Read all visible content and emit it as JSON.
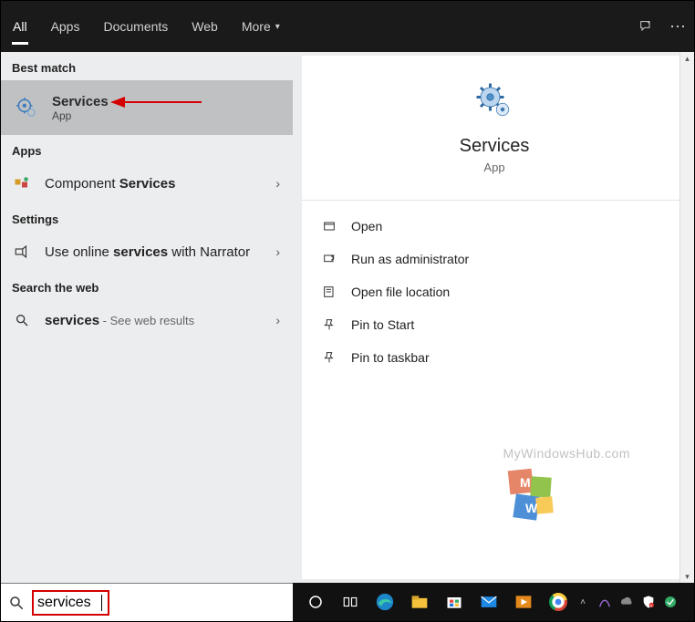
{
  "tabs": {
    "all": "All",
    "apps": "Apps",
    "documents": "Documents",
    "web": "Web",
    "more": "More"
  },
  "sections": {
    "best_match": "Best match",
    "apps": "Apps",
    "settings": "Settings",
    "search_web": "Search the web"
  },
  "best_match": {
    "title": "Services",
    "subtitle": "App"
  },
  "apps_list": {
    "component_pre": "Component ",
    "component_bold": "Services"
  },
  "settings_list": {
    "narrator_pre": "Use online ",
    "narrator_bold": "services",
    "narrator_post": " with Narrator"
  },
  "web_list": {
    "term_bold": "services",
    "term_rest": " - See web results"
  },
  "preview": {
    "title": "Services",
    "subtitle": "App"
  },
  "actions": {
    "open": "Open",
    "run_admin": "Run as administrator",
    "open_loc": "Open file location",
    "pin_start": "Pin to Start",
    "pin_taskbar": "Pin to taskbar"
  },
  "watermark": "MyWindowsHub.com",
  "search": {
    "value": "services"
  }
}
